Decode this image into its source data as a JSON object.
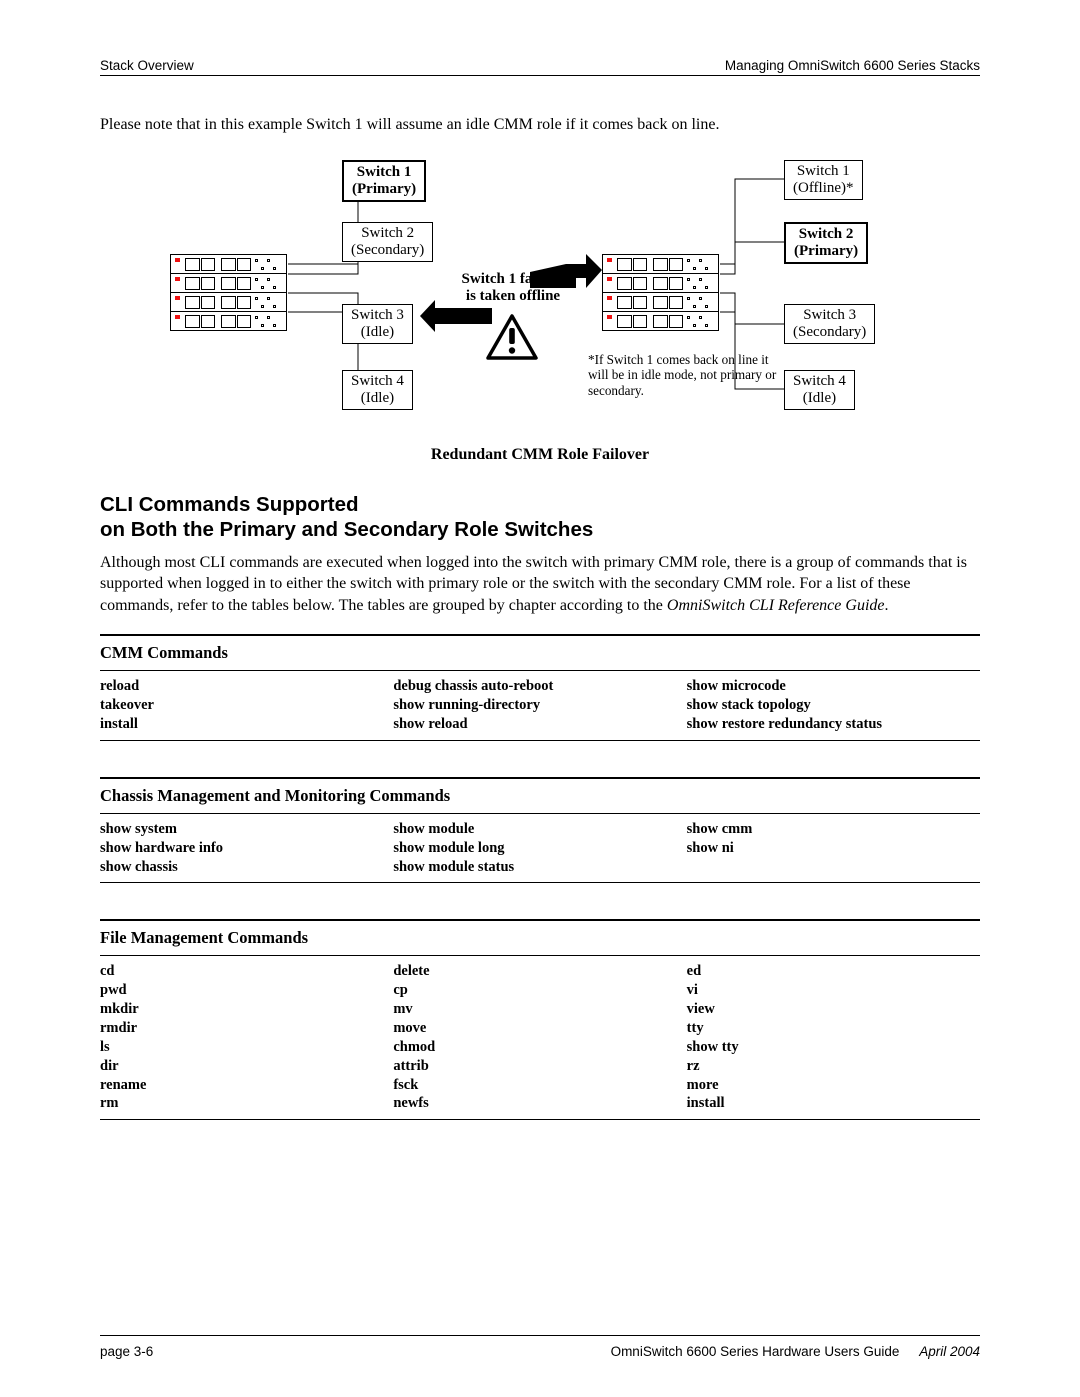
{
  "header": {
    "left": "Stack Overview",
    "right": "Managing OmniSwitch 6600 Series Stacks"
  },
  "intro": "Please note that in this example Switch 1 will assume an idle CMM role if it comes back on line.",
  "diagram": {
    "left_labels": [
      {
        "line1": "Switch 1",
        "line2": "(Primary)",
        "bold": true
      },
      {
        "line1": "Switch 2",
        "line2": "(Secondary)",
        "bold": false
      },
      {
        "line1": "Switch 3",
        "line2": "(Idle)",
        "bold": false
      },
      {
        "line1": "Switch 4",
        "line2": "(Idle)",
        "bold": false
      }
    ],
    "right_labels": [
      {
        "line1": "Switch 1",
        "line2": "(Offline)*",
        "bold": false
      },
      {
        "line1": "Switch 2",
        "line2": "(Primary)",
        "bold": true
      },
      {
        "line1": "Switch 3",
        "line2": "(Secondary)",
        "bold": false
      },
      {
        "line1": "Switch 4",
        "line2": "(Idle)",
        "bold": false
      }
    ],
    "center_note_line1": "Switch 1 fails or",
    "center_note_line2": "is taken offline",
    "footnote": "*If Switch 1 comes back on line it will be in idle mode, not primary or secondary.",
    "caption": "Redundant CMM Role Failover"
  },
  "section_title_l1": "CLI Commands Supported",
  "section_title_l2": "on Both the Primary and Secondary Role Switches",
  "body_para_plain": "Although most CLI commands are executed when logged into the switch with primary CMM role, there is a group of commands that is supported when logged in to either the switch with primary role or the switch with the secondary CMM role. For a list of these commands, refer to the tables below. The tables are grouped by chapter according to the ",
  "body_para_em": "OmniSwitch CLI Reference Guide",
  "body_para_tail": ".",
  "tables": [
    {
      "title": "CMM Commands",
      "cols": [
        [
          "reload",
          "takeover",
          "install"
        ],
        [
          "debug chassis auto-reboot",
          "show running-directory",
          "show reload"
        ],
        [
          "show microcode",
          "show stack topology",
          "show restore redundancy status"
        ]
      ]
    },
    {
      "title": "Chassis Management and Monitoring Commands",
      "cols": [
        [
          "show system",
          "show hardware info",
          "show chassis"
        ],
        [
          "show module",
          "show module long",
          "show module status"
        ],
        [
          "show cmm",
          "show ni"
        ]
      ]
    },
    {
      "title": "File Management Commands",
      "cols": [
        [
          "cd",
          "pwd",
          "mkdir",
          "rmdir",
          "ls",
          "dir",
          "rename",
          "rm"
        ],
        [
          "delete",
          "cp",
          "mv",
          "move",
          "chmod",
          "attrib",
          "fsck",
          "newfs"
        ],
        [
          "ed",
          "vi",
          "view",
          "tty",
          "show tty",
          "rz",
          "more",
          "install"
        ]
      ]
    }
  ],
  "footer": {
    "page": "page 3-6",
    "guide": "OmniSwitch 6600 Series Hardware Users Guide",
    "date": "April 2004"
  }
}
